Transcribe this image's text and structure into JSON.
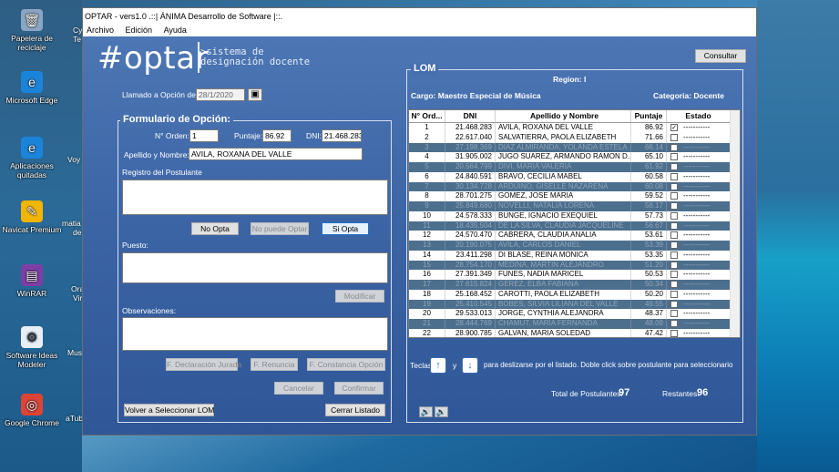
{
  "desktop": {
    "icons": [
      {
        "label": "Papelera de reciclaje",
        "glyph": "🗑"
      },
      {
        "label": "Microsoft Edge",
        "glyph": "e"
      },
      {
        "label": "Aplicaciones quitadas",
        "glyph": "e"
      },
      {
        "label": "Navicat Premium",
        "glyph": "✎"
      },
      {
        "label": "WinRAR",
        "glyph": "▤"
      },
      {
        "label": "Software Ideas Modeler",
        "glyph": "⚙"
      },
      {
        "label": "Google Chrome",
        "glyph": "◎"
      }
    ],
    "partial_labels": [
      "Cy",
      "Te",
      "Voy",
      "matia",
      "de",
      "Ora",
      "Vir",
      "Mus",
      "aTub"
    ]
  },
  "window": {
    "title": "OPTAR - vers1.0 .::| ÁNIMA Desarrollo de Software |::.",
    "menu": [
      "Archivo",
      "Edición",
      "Ayuda"
    ]
  },
  "logo": {
    "text": "#optar",
    "subtitle_line1": ">sistema de",
    "subtitle_line2": "designación docente"
  },
  "form": {
    "llamado_label": "Llamado a Opción del:",
    "llamado_value": "28/1/2020",
    "section_title": "Formulario de Opción:",
    "orden_label": "N° Orden:",
    "orden_value": "1",
    "puntaje_label": "Puntaje:",
    "puntaje_value": "86.92",
    "dni_label": "DNI:",
    "dni_value": "21.468.283",
    "apellido_label": "Apellido y Nombre:",
    "apellido_value": "AVILA, ROXANA DEL VALLE",
    "registro_label": "Registro del Postulante",
    "no_opta": "No Opta",
    "no_puede": "No puede Optar",
    "si_opta": "Si Opta",
    "puesto_label": "Puesto:",
    "modificar": "Modificar",
    "observaciones_label": "Observaciones:",
    "f_declaracion": "F. Declaración Jurada",
    "f_renuncia": "F. Renuncia",
    "f_constancia": "F. Constancia Opción",
    "cancelar": "Cancelar",
    "confirmar": "Confirmar",
    "volver": "Volver a Seleccionar LOM",
    "cerrar": "Cerrar Listado"
  },
  "lom": {
    "consultar": "Consultar",
    "title": "LOM",
    "region": "Region: I",
    "cargo": "Cargo: Maestro Especial de Música",
    "categoria": "Categoria: Docente",
    "columns": [
      "N° Ord...",
      "DNI",
      "Apellido y Nombre",
      "Puntaje",
      "Estado"
    ],
    "rows": [
      {
        "n": "1",
        "dni": "21.468.283",
        "name": "AVILA, ROXANA DEL VALLE",
        "pts": "86.92",
        "estado": "-----------",
        "checked": true,
        "alt": false
      },
      {
        "n": "2",
        "dni": "22.617.040",
        "name": "SALVATIERRA, PAOLA ELIZABETH",
        "pts": "71.66",
        "estado": "-----------",
        "checked": false,
        "alt": false
      },
      {
        "n": "3",
        "dni": "27.198.369",
        "name": "DIAZ ALMIRANDA, YOLANDA ESTELA",
        "pts": "66.14",
        "estado": "-----------",
        "checked": false,
        "alt": true
      },
      {
        "n": "4",
        "dni": "31.905.002",
        "name": "JUGO SUAREZ, ARMANDO RAMON D...",
        "pts": "65.10",
        "estado": "-----------",
        "checked": false,
        "alt": false
      },
      {
        "n": "5",
        "dni": "20.564.799",
        "name": "DIVI, MARIA VALERIA",
        "pts": "61.92",
        "estado": "-----------",
        "checked": false,
        "alt": true
      },
      {
        "n": "6",
        "dni": "24.840.591",
        "name": "BRAVO, CECILIA MABEL",
        "pts": "60.58",
        "estado": "-----------",
        "checked": false,
        "alt": false
      },
      {
        "n": "7",
        "dni": "30.134.728",
        "name": "ARDUINO, GISELLE NAZARENA",
        "pts": "60.08",
        "estado": "-----------",
        "checked": false,
        "alt": true
      },
      {
        "n": "8",
        "dni": "28.701.275",
        "name": "GOMEZ, JOSE MARIA",
        "pts": "59.52",
        "estado": "-----------",
        "checked": false,
        "alt": false
      },
      {
        "n": "9",
        "dni": "25.849.680",
        "name": "NOVELLI, NATALIA LORENA",
        "pts": "58.17",
        "estado": "-----------",
        "checked": false,
        "alt": true
      },
      {
        "n": "10",
        "dni": "24.578.333",
        "name": "BUNGE, IGNACIO EXEQUIEL",
        "pts": "57.73",
        "estado": "-----------",
        "checked": false,
        "alt": false
      },
      {
        "n": "11",
        "dni": "18.435.504",
        "name": "DE LA SILVA, CLAUDIA JACQUELINE",
        "pts": "56.67",
        "estado": "-----------",
        "checked": false,
        "alt": true
      },
      {
        "n": "12",
        "dni": "24.570.470",
        "name": "CABRERA, CLAUDIA ANALIA",
        "pts": "53.61",
        "estado": "-----------",
        "checked": false,
        "alt": false
      },
      {
        "n": "13",
        "dni": "20.190.075",
        "name": "AVILA, CARLOS DANIEL",
        "pts": "53.39",
        "estado": "-----------",
        "checked": false,
        "alt": true
      },
      {
        "n": "14",
        "dni": "23.411.298",
        "name": "DI BLASE, REINA MONICA",
        "pts": "53.35",
        "estado": "-----------",
        "checked": false,
        "alt": false
      },
      {
        "n": "15",
        "dni": "28.754.170",
        "name": "MEDINA, MARTIN ALEJANDRO",
        "pts": "51.20",
        "estado": "-----------",
        "checked": false,
        "alt": true
      },
      {
        "n": "16",
        "dni": "27.391.349",
        "name": "FUNES, NADIA MARICEL",
        "pts": "50.53",
        "estado": "-----------",
        "checked": false,
        "alt": false
      },
      {
        "n": "17",
        "dni": "27.615.824",
        "name": "GEREZ, ELBA FABIANA",
        "pts": "50.34",
        "estado": "-----------",
        "checked": false,
        "alt": true
      },
      {
        "n": "18",
        "dni": "25.168.452",
        "name": "CAROTTI, PAOLA ELIZABETH",
        "pts": "50.20",
        "estado": "-----------",
        "checked": false,
        "alt": false
      },
      {
        "n": "19",
        "dni": "25.410.545",
        "name": "BOBES, SILVIA LILIANA DEL VALLE",
        "pts": "49.55",
        "estado": "-----------",
        "checked": false,
        "alt": true
      },
      {
        "n": "20",
        "dni": "29.533.013",
        "name": "JORGE, CYNTHIA ALEJANDRA",
        "pts": "48.37",
        "estado": "-----------",
        "checked": false,
        "alt": false
      },
      {
        "n": "21",
        "dni": "28.444.769",
        "name": "CHAMUT, MARIA FERNANDA",
        "pts": "48.09",
        "estado": "-----------",
        "checked": false,
        "alt": true
      },
      {
        "n": "22",
        "dni": "28.900.785",
        "name": "GALVAN, MARIA SOLEDAD",
        "pts": "47.42",
        "estado": "-----------",
        "checked": false,
        "alt": false
      }
    ],
    "teclas_label": "Teclas",
    "y_label": "y",
    "help_text": "para deslizarse por el listado. Doble click sobre postulante para seleccionario",
    "total_label": "Total de Postulantes:",
    "total_value": "97",
    "restantes_label": "Restantes:",
    "restantes_value": "96"
  }
}
